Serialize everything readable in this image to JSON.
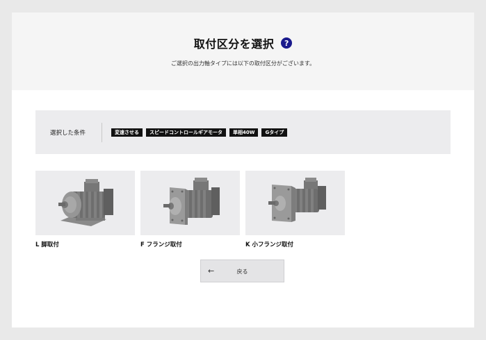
{
  "header": {
    "title": "取付区分を選択",
    "help_icon": "question-mark",
    "help_symbol": "?",
    "subtitle": "ご選択の出力軸タイプには以下の取付区分がございます。"
  },
  "conditions": {
    "label": "選択した条件",
    "tags": [
      "変速させる",
      "スピードコントロールギアモータ",
      "単相40W",
      "Gタイプ"
    ]
  },
  "mount_options": [
    {
      "label": "L 脚取付",
      "icon": "foot-mount-motor"
    },
    {
      "label": "F フランジ取付",
      "icon": "flange-mount-motor"
    },
    {
      "label": "K 小フランジ取付",
      "icon": "small-flange-mount-motor"
    }
  ],
  "back_button": {
    "arrow": "←",
    "label": "戻る"
  },
  "colors": {
    "page_bg": "#e9e9e9",
    "header_bg": "#f5f5f5",
    "tag_bg": "#111111",
    "help_icon_bg": "#1a1a8c"
  }
}
